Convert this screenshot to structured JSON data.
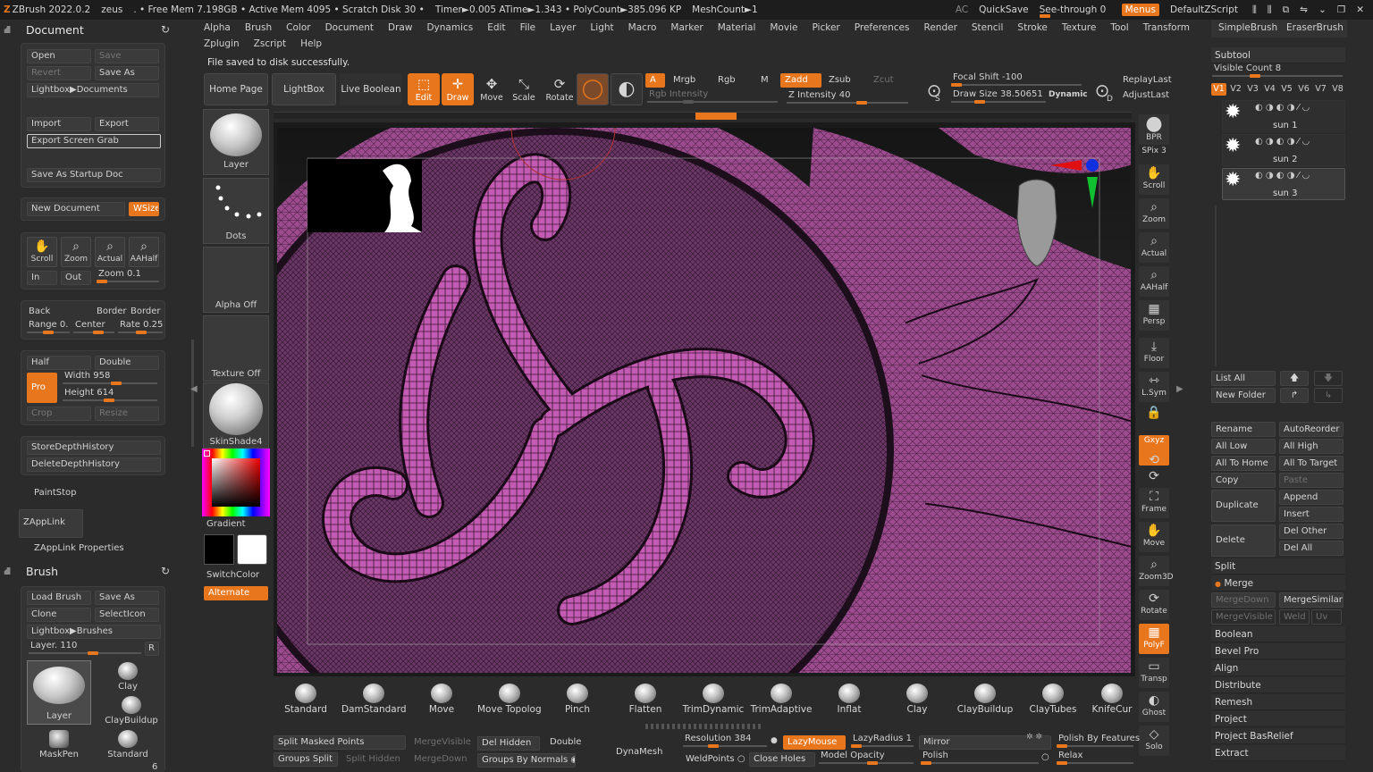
{
  "topbar": {
    "app": "ZBrush 2022.0.2",
    "user": "zeus",
    "stats": ". • Free Mem 7.198GB • Active Mem 4095 • Scratch Disk 30 •",
    "timer": "Timer►0.005 ATime►1.343 • PolyCount►385.096 KP",
    "meshcount": "MeshCount►1",
    "ac": "AC",
    "quicksave": "QuickSave",
    "seethrough": "See-through",
    "seethrough_value": "0",
    "menus": "Menus",
    "script": "DefaultZScript"
  },
  "menus": {
    "row1": [
      "Alpha",
      "Brush",
      "Color",
      "Document",
      "Draw",
      "Dynamics",
      "Edit",
      "File",
      "Layer",
      "Light",
      "Macro",
      "Marker",
      "Material",
      "Movie",
      "Picker",
      "Preferences",
      "Render",
      "Stencil",
      "Stroke",
      "Texture",
      "Tool",
      "Transform"
    ],
    "row2": [
      "Zplugin",
      "Zscript",
      "Help"
    ]
  },
  "status_message": "File saved to disk successfully.",
  "document_panel": {
    "title": "Document",
    "open": "Open",
    "save": "Save",
    "revert": "Revert",
    "save_as": "Save As",
    "lightbox_documents": "Lightbox▶Documents",
    "import": "Import",
    "export": "Export",
    "export_screen_grab": "Export Screen Grab",
    "save_as_startup": "Save As Startup Doc",
    "new_document": "New Document",
    "wsize": "WSize",
    "scroll": "Scroll",
    "zoom": "Zoom",
    "actual": "Actual",
    "aahalf": "AAHalf",
    "in": "In",
    "out": "Out",
    "zoom_value": "Zoom 0.1",
    "back": "Back",
    "border1": "Border",
    "border2": "Border",
    "range": "Range 0.",
    "center": "Center",
    "rate": "Rate 0.25",
    "half": "Half",
    "double": "Double",
    "pro": "Pro",
    "width": "Width 958",
    "height": "Height 614",
    "crop": "Crop",
    "resize": "Resize",
    "store_depth": "StoreDepthHistory",
    "delete_depth": "DeleteDepthHistory",
    "paintstop": "PaintStop",
    "zapplink": "ZAppLink",
    "zapplink_props": "ZAppLink Properties"
  },
  "brush_panel": {
    "title": "Brush",
    "load_brush": "Load Brush",
    "save_as": "Save As",
    "clone": "Clone",
    "select_icon": "SelectIcon",
    "lightbox_brushes": "Lightbox▶Brushes",
    "layer_value": "Layer. 110",
    "r": "R",
    "current": "Layer",
    "clay": "Clay",
    "claybuildup": "ClayBuildup",
    "maskpen": "MaskPen",
    "standard": "Standard",
    "count": "6"
  },
  "shelf": {
    "layer": "Layer",
    "dots": "Dots",
    "alpha_off": "Alpha Off",
    "texture_off": "Texture Off",
    "skinshade": "SkinShade4",
    "gradient": "Gradient",
    "switchcolor": "SwitchColor",
    "alternate": "Alternate"
  },
  "toolbar": {
    "home_page": "Home Page",
    "lightbox": "LightBox",
    "live_boolean": "Live Boolean",
    "edit": "Edit",
    "draw": "Draw",
    "move": "Move",
    "scale": "Scale",
    "rotate": "Rotate",
    "a": "A",
    "mrgb": "Mrgb",
    "rgb": "Rgb",
    "m": "M",
    "zadd": "Zadd",
    "zsub": "Zsub",
    "zcut": "Zcut",
    "rgb_intensity": "Rgb Intensity",
    "z_intensity": "Z Intensity 40",
    "focal_shift": "Focal Shift -100",
    "draw_size": "Draw Size 38.50651",
    "dynamic": "Dynamic",
    "replaylast": "ReplayLast",
    "adjustlast": "AdjustLast",
    "s": "S",
    "d": "D"
  },
  "right_rail": [
    "BPR",
    "SPix 3",
    "Scroll",
    "Zoom",
    "Actual",
    "AAHalf",
    "Persp",
    "Floor",
    "L.Sym",
    "",
    "Gxyz",
    "",
    "",
    "Frame",
    "Move",
    "Zoom3D",
    "Rotate",
    "PolyF",
    "Transp",
    "Ghost",
    "Solo"
  ],
  "brushes_bottom": [
    "Standard",
    "DamStandard",
    "Move",
    "Move Topologic",
    "Pinch",
    "Flatten",
    "TrimDynamic",
    "TrimAdaptive",
    "Inflat",
    "Clay",
    "ClayBuildup",
    "ClayTubes",
    "KnifeCur"
  ],
  "bottom_controls": {
    "split_masked": "Split Masked Points",
    "mergevisible": "MergeVisible",
    "del_hidden": "Del Hidden",
    "double": "Double",
    "groups_split": "Groups Split",
    "split_hidden": "Split Hidden",
    "mergedown": "MergeDown",
    "groups_by_normals": "Groups By Normals",
    "dynamesh": "DynaMesh",
    "resolution": "Resolution 384",
    "lazymouse": "LazyMouse",
    "lazyradius": "LazyRadius 1",
    "weldpoints": "WeldPoints",
    "close_holes": "Close Holes",
    "model_opacity": "Model Opacity",
    "mirror": "Mirror",
    "polish": "Polish",
    "polish_by_features": "Polish By Features",
    "relax": "Relax"
  },
  "right_panel": {
    "simplebrush": "SimpleBrush",
    "eraserbrush": "EraserBrush",
    "subtool": "Subtool",
    "visible_count": "Visible Count 8",
    "versions": [
      "V1",
      "V2",
      "V3",
      "V4",
      "V5",
      "V6",
      "V7",
      "V8"
    ],
    "subtools": [
      "sun 1",
      "sun 2",
      "sun 3"
    ],
    "list_all": "List All",
    "new_folder": "New Folder",
    "rename": "Rename",
    "autoreorder": "AutoReorder",
    "all_low": "All Low",
    "all_high": "All High",
    "all_to_home": "All To Home",
    "all_to_target": "All To Target",
    "copy": "Copy",
    "paste": "Paste",
    "duplicate": "Duplicate",
    "append": "Append",
    "insert": "Insert",
    "delete": "Delete",
    "del_other": "Del Other",
    "del_all": "Del All",
    "sections": [
      "Split",
      "Merge"
    ],
    "mergedown": "MergeDown",
    "mergesimilar": "MergeSimilar",
    "mergevisible": "MergeVisible",
    "weld": "Weld",
    "uv": "Uv",
    "subsections": [
      "Boolean",
      "Bevel Pro",
      "Align",
      "Distribute",
      "Remesh",
      "Project",
      "Project BasRelief",
      "Extract"
    ]
  },
  "colors": {
    "accent": "#e8761c",
    "panel": "#2b2b2b",
    "model": "#b04f9f"
  }
}
